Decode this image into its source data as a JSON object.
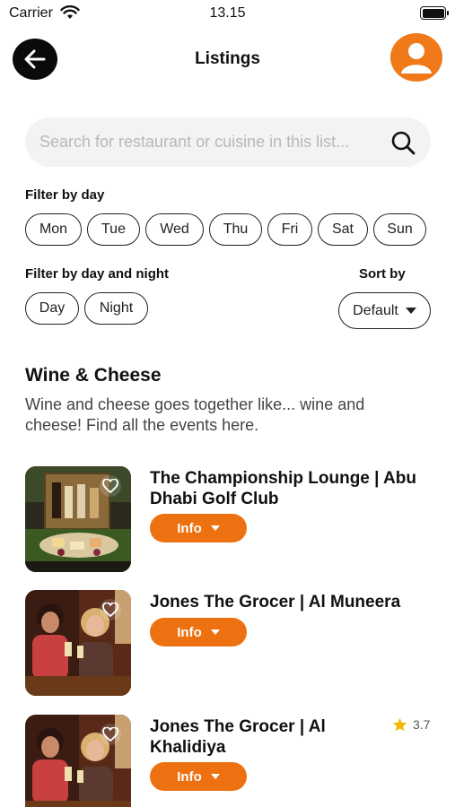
{
  "status": {
    "carrier": "Carrier",
    "time": "13.15"
  },
  "header": {
    "title": "Listings"
  },
  "search": {
    "placeholder": "Search for restaurant or cuisine in this list..."
  },
  "filter_day": {
    "label": "Filter by day",
    "days": [
      "Mon",
      "Tue",
      "Wed",
      "Thu",
      "Fri",
      "Sat",
      "Sun"
    ]
  },
  "filter_daynight": {
    "label": "Filter by day and night",
    "options": [
      "Day",
      "Night"
    ]
  },
  "sort": {
    "label": "Sort by",
    "value": "Default"
  },
  "category": {
    "title": "Wine & Cheese",
    "description": "Wine and cheese goes together like... wine and cheese!  Find all the events here."
  },
  "listings": [
    {
      "title": "The Championship Lounge | Abu Dhabi Golf Club",
      "button": "Info",
      "rating": ""
    },
    {
      "title": "Jones The Grocer | Al Muneera",
      "button": "Info",
      "rating": ""
    },
    {
      "title": "Jones The Grocer | Al Khalidiya",
      "button": "Info",
      "rating": "3.7"
    }
  ],
  "colors": {
    "accent": "#ee7111",
    "avatar": "#f07a1a",
    "star": "#f5b800"
  }
}
